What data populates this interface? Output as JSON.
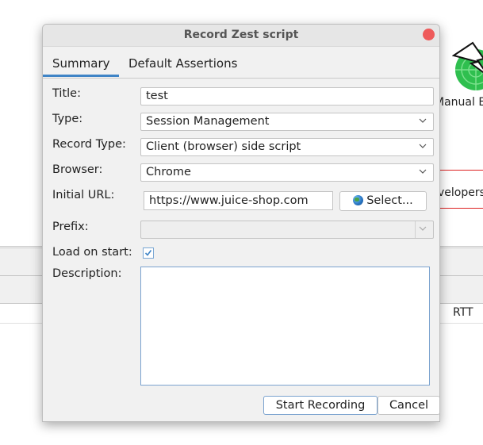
{
  "background": {
    "toolbar_label": "Manual E",
    "banner_text": "velopers",
    "table_header_rtt": "RTT"
  },
  "dialog": {
    "title": "Record Zest script",
    "tabs": [
      {
        "label": "Summary",
        "active": true
      },
      {
        "label": "Default Assertions",
        "active": false
      }
    ],
    "form": {
      "title_label": "Title:",
      "title_value": "test",
      "type_label": "Type:",
      "type_value": "Session Management",
      "record_type_label": "Record Type:",
      "record_type_value": "Client (browser) side script",
      "browser_label": "Browser:",
      "browser_value": "Chrome",
      "initial_url_label": "Initial URL:",
      "initial_url_value": "https://www.juice-shop.com",
      "select_button": "Select...",
      "prefix_label": "Prefix:",
      "prefix_value": "",
      "load_on_start_label": "Load on start:",
      "load_on_start_checked": true,
      "description_label": "Description:",
      "description_value": ""
    },
    "buttons": {
      "start_recording": "Start Recording",
      "cancel": "Cancel"
    },
    "colors": {
      "accent": "#3f84c6",
      "close": "#ee5a5a"
    }
  }
}
